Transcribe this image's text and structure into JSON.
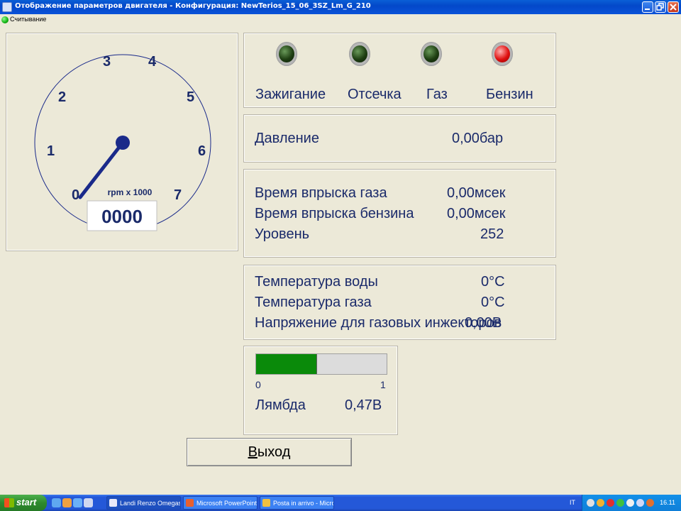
{
  "window": {
    "title": "Отображение параметров двигателя - Конфигурация: NewTerios_15_06_3SZ_Lm_G_210",
    "status": "Считывание"
  },
  "tachometer": {
    "scale_labels": [
      "0",
      "1",
      "2",
      "3",
      "4",
      "5",
      "6",
      "7"
    ],
    "unit_label": "rpm x 1000",
    "readout": "0000",
    "needle_value": 0.6
  },
  "indicators": [
    {
      "label": "Зажигание",
      "state": "off"
    },
    {
      "label": "Отсечка",
      "state": "off"
    },
    {
      "label": "Газ",
      "state": "off"
    },
    {
      "label": "Бензин",
      "state": "on"
    }
  ],
  "pressure": {
    "label": "Давление",
    "value": "0,00бар"
  },
  "injection": {
    "rows": [
      {
        "label": "Время впрыска газа",
        "value": "0,00мсек"
      },
      {
        "label": "Время впрыска бензина",
        "value": "0,00мсек"
      },
      {
        "label": "Уровень",
        "value": "252"
      }
    ]
  },
  "temperatures": {
    "rows": [
      {
        "label": "Температура воды",
        "value": "0°C"
      },
      {
        "label": "Температура газа",
        "value": "0°C"
      },
      {
        "label": "Напряжение для газовых инжекторов",
        "value": "0,00В"
      }
    ]
  },
  "lambda": {
    "min_label": "0",
    "max_label": "1",
    "fill_fraction": 0.47,
    "label": "Лямбда",
    "value": "0,47В"
  },
  "exit_button": {
    "accel": "В",
    "rest": "ыход"
  },
  "taskbar": {
    "start": "start",
    "tasks": [
      "Landi Renzo Omegas",
      "Microsoft PowerPoint ...",
      "Posta in arrivo - Micro..."
    ],
    "language": "IT",
    "clock": "16.11"
  },
  "colors": {
    "gauge_blue": "#1a2a8a",
    "lambda_green": "#0a8a0a",
    "lamp_red": "#e01010",
    "lamp_green_dark": "#1e3e12"
  }
}
